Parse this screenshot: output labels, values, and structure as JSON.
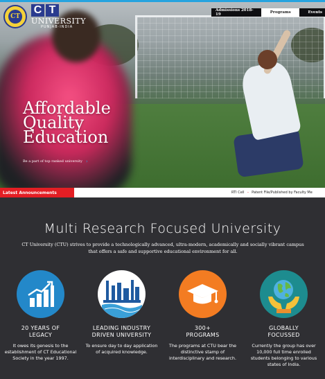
{
  "header": {
    "logo": {
      "letters": [
        "C",
        "T"
      ],
      "name": "UNIVERSITY",
      "sub": "PUNJAB·INDIA",
      "seal": "CT"
    },
    "nav": {
      "items": [
        "Admissions 2018-19",
        "Programs",
        "Events"
      ],
      "active_index": 1
    }
  },
  "hero": {
    "headline_lines": [
      "Affordable",
      "Quality",
      "Education"
    ],
    "tagline": "Be a part of top ranked university",
    "tagline_arrow": "›"
  },
  "announcements": {
    "label": "Latest Announcements",
    "links": [
      "RTI Cell",
      "Patent File/Published by Faculty Me"
    ]
  },
  "main": {
    "title": "Multi Research Focused University",
    "description": "CT University (CTU) strives to provide a technologically advanced, ultra-modern, academically and socially vibrant campus that offers a safe and supportive educational environment for all.",
    "cards": [
      {
        "icon": "growth-chart-icon",
        "color": "#2388c9",
        "title": "20 YEARS OF LEGACY",
        "text": "It owes its genesis to the establishment of CT Educational Society in the year 1997."
      },
      {
        "icon": "industry-icon",
        "color": "#ffffff",
        "title": "LEADING INDUSTRY DRIVEN UNIVERSITY",
        "text": "To ensure day to day application of acquired knowledge."
      },
      {
        "icon": "graduation-cap-icon",
        "color": "#f37c22",
        "title": "300+ PROGRAMS",
        "text": "The programs at CTU bear the distinctive stamp of interdisciplinary and research."
      },
      {
        "icon": "globe-hands-icon",
        "color": "#1d8c8f",
        "title": "GLOBALLY FOCUSSED",
        "text": "Currently the group has over 10,000 full time enrolled students belonging to various states of India."
      }
    ]
  }
}
